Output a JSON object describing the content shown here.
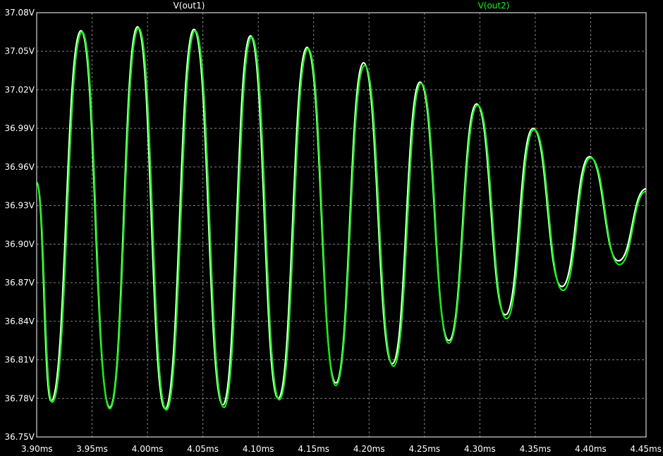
{
  "chart_data": {
    "type": "line",
    "xlabel": "",
    "ylabel": "",
    "xlim": [
      3.9,
      4.45
    ],
    "ylim": [
      36.75,
      37.08
    ],
    "grid": true,
    "x_ticks": [
      "3.90ms",
      "3.95ms",
      "4.00ms",
      "4.05ms",
      "4.10ms",
      "4.15ms",
      "4.20ms",
      "4.25ms",
      "4.30ms",
      "4.35ms",
      "4.40ms",
      "4.45ms"
    ],
    "y_ticks": [
      "37.08V",
      "37.05V",
      "37.02V",
      "36.99V",
      "36.96V",
      "36.93V",
      "36.90V",
      "36.87V",
      "36.84V",
      "36.81V",
      "36.78V",
      "36.75V"
    ],
    "series": [
      {
        "name": "V(out1)",
        "color": "#ffffff",
        "x": [
          3.9,
          3.913,
          3.94,
          3.966,
          3.991,
          4.016,
          4.042,
          4.068,
          4.093,
          4.118,
          4.144,
          4.17,
          4.195,
          4.221,
          4.246,
          4.272,
          4.297,
          4.323,
          4.348,
          4.374,
          4.399,
          4.425,
          4.45
        ],
        "y": [
          36.948,
          36.778,
          37.066,
          36.773,
          37.069,
          36.772,
          37.067,
          36.775,
          37.062,
          36.78,
          37.053,
          36.792,
          37.041,
          36.807,
          37.026,
          36.825,
          37.009,
          36.845,
          36.99,
          36.867,
          36.968,
          36.887,
          36.943
        ]
      },
      {
        "name": "V(out2)",
        "color": "#00ff00",
        "x": [
          3.9,
          3.914,
          3.941,
          3.966,
          3.992,
          4.017,
          4.043,
          4.069,
          4.094,
          4.119,
          4.145,
          4.17,
          4.196,
          4.222,
          4.247,
          4.272,
          4.298,
          4.324,
          4.349,
          4.375,
          4.4,
          4.426,
          4.45
        ],
        "y": [
          36.948,
          36.777,
          37.065,
          36.772,
          37.068,
          36.771,
          37.066,
          36.773,
          37.061,
          36.779,
          37.052,
          36.79,
          37.039,
          36.805,
          37.025,
          36.823,
          37.008,
          36.842,
          36.989,
          36.864,
          36.967,
          36.884,
          36.941
        ]
      }
    ]
  }
}
